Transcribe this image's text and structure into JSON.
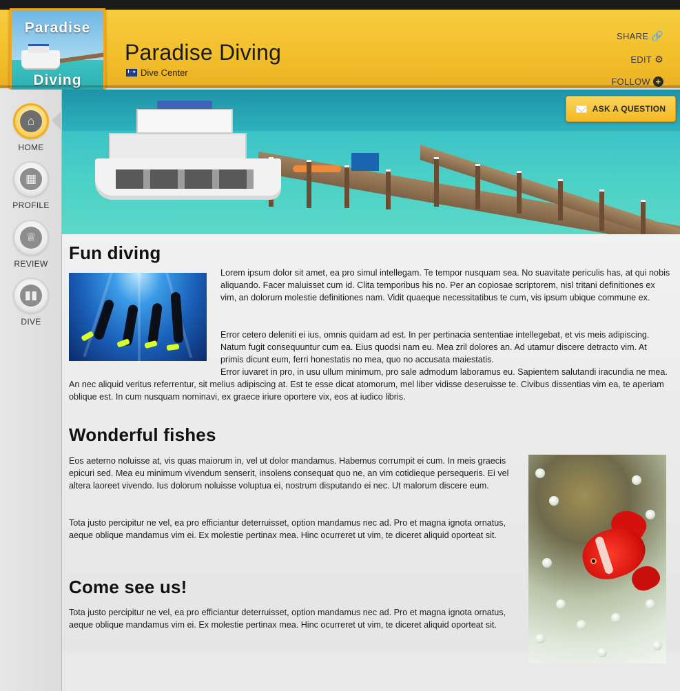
{
  "header": {
    "logo_line1": "Paradise",
    "logo_line2": "Diving",
    "title": "Paradise Diving",
    "subtitle": "Dive Center",
    "share_label": "SHARE",
    "edit_label": "EDIT",
    "follow_label": "FOLLOW"
  },
  "sidebar": {
    "items": [
      {
        "label": "HOME",
        "icon": "home-icon",
        "active": true
      },
      {
        "label": "PROFILE",
        "icon": "map-pin-icon",
        "active": false
      },
      {
        "label": "REVIEW",
        "icon": "trophy-icon",
        "active": false
      },
      {
        "label": "DIVE",
        "icon": "scuba-tank-icon",
        "active": false
      }
    ]
  },
  "banner": {
    "ask_button_label": "ASK A QUESTION",
    "ask_button_icon": "envelope-icon"
  },
  "sections": [
    {
      "heading": "Fun diving",
      "p1": "Lorem ipsum dolor sit amet, ea pro simul intellegam. Te tempor nusquam sea. No suavitate periculis has, at qui nobis aliquando. Facer maluisset cum id. Clita temporibus his no. Per an copiosae scriptorem, nisl tritani definitiones ex vim, an dolorum molestie definitiones nam. Vidit quaeque necessitatibus te cum, vis ipsum ubique commune ex.",
      "p2": "Error cetero deleniti ei ius, omnis quidam ad est. In per pertinacia sententiae intellegebat, et vis meis adipiscing. Natum fugit consequuntur cum ea. Eius quodsi nam eu. Mea zril dolores an. Ad utamur discere detracto vim. At primis dicunt eum, ferri honestatis no mea, quo no accusata maiestatis.",
      "p3": "Error iuvaret in pro, in usu ullum minimum, pro sale admodum laboramus eu. Sapientem salutandi iracundia ne mea. An nec aliquid veritus referrentur, sit melius adipiscing at. Est te esse dicat atomorum, mel liber vidisse deseruisse te. Civibus dissentias vim ea, te aperiam oblique est. In cum nusquam nominavi, ex graece iriure oportere vix, eos at iudico libris."
    },
    {
      "heading": "Wonderful fishes",
      "p1": "Eos aeterno noluisse at, vis quas maiorum in, vel ut dolor mandamus. Habemus corrumpit ei cum. In meis graecis epicuri sed. Mea eu minimum vivendum senserit, insolens consequat quo ne, an vim cotidieque persequeris. Ei vel altera laoreet vivendo. Ius dolorum noluisse voluptua ei, nostrum disputando ei nec. Ut malorum discere eum.",
      "p2": "Tota justo percipitur ne vel, ea pro efficiantur deterruisset, option mandamus nec ad. Pro et magna ignota ornatus, aeque oblique mandamus vim ei. Ex molestie pertinax mea. Hinc ocurreret ut vim, te diceret aliquid oporteat sit."
    },
    {
      "heading": "Come see us!",
      "p1": "Tota justo percipitur ne vel, ea pro efficiantur deterruisset, option mandamus nec ad. Pro et magna ignota ornatus, aeque oblique mandamus vim ei. Ex molestie pertinax mea. Hinc ocurreret ut vim, te diceret aliquid oporteat sit."
    }
  ],
  "colors": {
    "header_yellow": "#f3bf2b",
    "accent_orange": "#f0a21e",
    "content_bg": "#eeeeee"
  }
}
